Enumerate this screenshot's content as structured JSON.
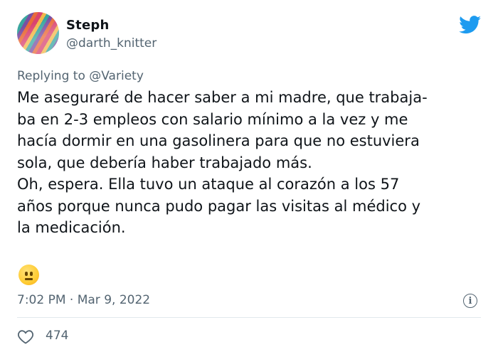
{
  "user": {
    "name": "Steph",
    "handle": "@darth_knitter"
  },
  "reply": {
    "prefix": "Replying to",
    "target": "@Variety"
  },
  "tweet": {
    "lines": [
      "Me aseguraré de hacer saber a mi madre, que trabaja-",
      "ba en 2-3 empleos con salario mínimo a la vez y me",
      "hacía dormir en una gasolinera para que no estuviera",
      "sola, que debería haber trabajado más.",
      "Oh, espera. Ella tuvo un ataque al corazón a los 57",
      "años porque nunca pudo pagar las visitas al médico y",
      "la medicación."
    ],
    "emoji": "neutral-face"
  },
  "meta": {
    "time": "7:02 PM",
    "separator": "·",
    "date": "Mar 9, 2022",
    "info_glyph": "i"
  },
  "stats": {
    "likes": "474"
  },
  "colors": {
    "text": "#0f1419",
    "secondary": "#536471",
    "twitter_blue": "#1d9bf0",
    "divider": "#e1e8ed"
  },
  "icons": [
    "twitter-bird-icon",
    "info-icon",
    "heart-icon",
    "neutral-face-emoji"
  ]
}
